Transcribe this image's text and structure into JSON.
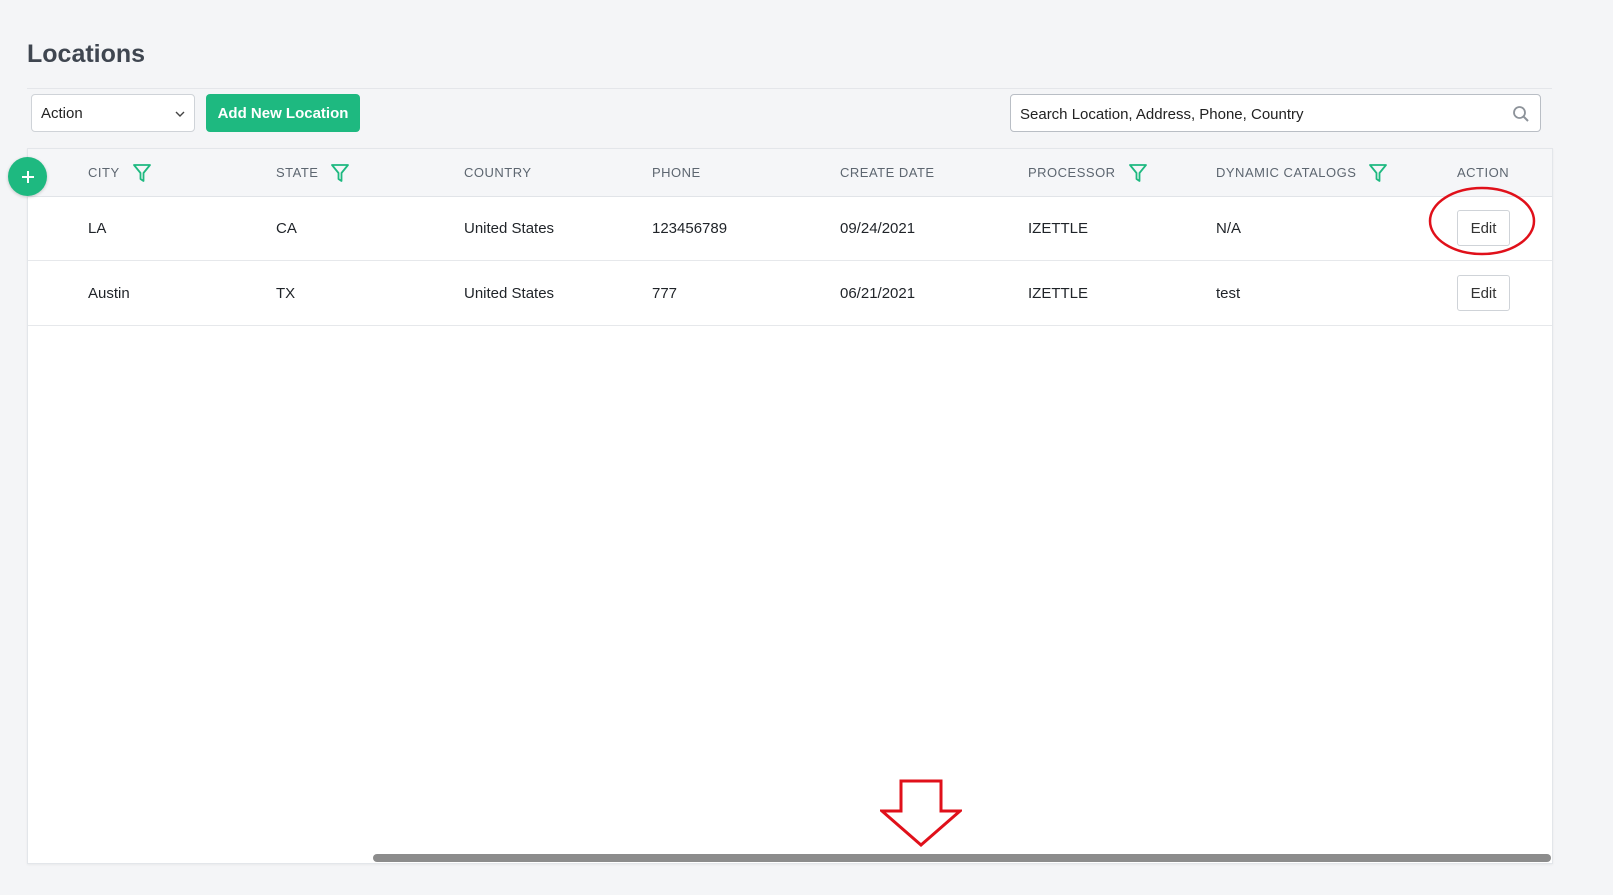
{
  "page": {
    "title": "Locations"
  },
  "toolbar": {
    "action_select_value": "Action",
    "add_button_label": "Add New Location",
    "search_placeholder": "Search Location, Address, Phone, Country"
  },
  "table": {
    "columns": [
      {
        "label": "CITY",
        "filterable": true
      },
      {
        "label": "STATE",
        "filterable": true
      },
      {
        "label": "COUNTRY",
        "filterable": false
      },
      {
        "label": "PHONE",
        "filterable": false
      },
      {
        "label": "CREATE DATE",
        "filterable": false
      },
      {
        "label": "PROCESSOR",
        "filterable": true
      },
      {
        "label": "DYNAMIC CATALOGS",
        "filterable": true
      },
      {
        "label": "ACTION",
        "filterable": false
      }
    ],
    "rows": [
      {
        "city": "LA",
        "state": "CA",
        "country": "United States",
        "phone": "123456789",
        "create_date": "09/24/2021",
        "processor": "IZETTLE",
        "dynamic_catalogs": "N/A",
        "action_label": "Edit"
      },
      {
        "city": "Austin",
        "state": "TX",
        "country": "United States",
        "phone": "777",
        "create_date": "06/21/2021",
        "processor": "IZETTLE",
        "dynamic_catalogs": "test",
        "action_label": "Edit"
      }
    ]
  },
  "icons": {
    "filter": "filter-icon",
    "search": "search-icon",
    "expand": "plus-icon",
    "select": "chevron-down-icon"
  },
  "colors": {
    "accent": "#1eb980",
    "annotation": "#e0101a",
    "scrollbar_thumb": "#8c8c8c"
  },
  "annotations": {
    "edit_button_circle": "red ellipse",
    "scroll_arrow": "red down-arrow"
  }
}
